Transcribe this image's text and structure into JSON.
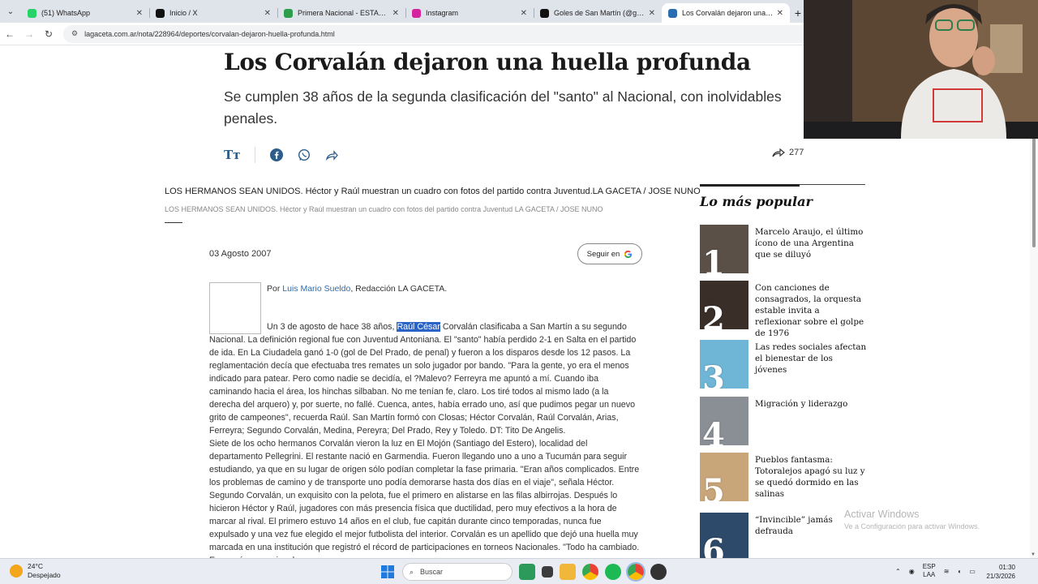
{
  "browser": {
    "tabs": [
      {
        "label": "(51) WhatsApp",
        "color": "#25d366",
        "active": false
      },
      {
        "label": "Inicio / X",
        "color": "#111111",
        "active": false
      },
      {
        "label": "Primera Nacional - ESTADÍSTIC",
        "color": "#2c9e4b",
        "active": false
      },
      {
        "label": "Instagram",
        "color": "#d6249f",
        "active": false
      },
      {
        "label": "Goles de San Martín (@goles.de",
        "color": "#111111",
        "active": false
      },
      {
        "label": "Los Corvalán dejaron una hue",
        "color": "#2a6db0",
        "active": true
      }
    ],
    "url": "lagaceta.com.ar/nota/228964/deportes/corvalan-dejaron-huella-profunda.html"
  },
  "article": {
    "headline": "Los Corvalán dejaron una huella profunda",
    "subhead": "Se cumplen 38 años de la segunda clasificación del \"santo\" al Nacional, con inolvidables penales.",
    "text_size_label": "Tт",
    "share_count": "277",
    "image_alt": "LOS HERMANOS SEAN UNIDOS. Héctor y Raúl muestran un cuadro con fotos del partido contra Juventud.LA GACETA / JOSE NUNO",
    "image_caption": "LOS HERMANOS SEAN UNIDOS. Héctor y Raúl muestran un cuadro con fotos del partido contra Juventud LA GACETA / JOSE NUNO",
    "date": "03 Agosto 2007",
    "follow_label": "Seguir en",
    "byline_prefix": "Por ",
    "author": "Luis Mario Sueldo",
    "byline_suffix": ", Redacción LA GACETA.",
    "para1_before": "Un 3 de agosto de hace 38 años, ",
    "para1_highlight": "Raúl César",
    "para1_after": " Corvalán clasificaba a San Martín a su segundo Nacional. La definición regional fue con Juventud Antoniana. El \"santo\" había perdido 2-1 en Salta en el partido de ida. En La Ciudadela ganó 1-0 (gol de Del Prado, de penal) y fueron a los disparos desde los 12 pasos. La reglamentación decía que efectuaba tres remates un solo jugador por bando. \"Para la gente, yo era el menos indicado para patear. Pero como nadie se decidía, el ?Malevo? Ferreyra me apuntó a mí. Cuando iba caminando hacia el área, los hinchas silbaban. No me tenían fe, claro. Los tiré todos al mismo lado (a la derecha del arquero) y, por suerte, no fallé. Cuenca, antes, había errado uno, así que pudimos pegar un nuevo grito de campeones\", recuerda Raúl. San Martín formó con Closas; Héctor Corvalán, Raúl Corvalán, Arias, Ferreyra; Segundo Corvalán, Medina, Pereyra; Del Prado, Rey y Toledo. DT: Tito De Angelis.",
    "para2": "Siete de los ocho hermanos Corvalán vieron la luz en El Mojón (Santiago del Estero), localidad del departamento Pellegrini. El restante nació en Garmendia. Fueron llegando uno a uno a Tucumán para seguir estudiando, ya que en su lugar de origen sólo podían completar la fase primaria. \"Eran años complicados. Entre los problemas de camino y de transporte uno podía demorarse hasta dos días en el viaje\", señala Héctor. Segundo Corvalán, un exquisito con la pelota, fue el primero en alistarse en las filas albirrojas. Después lo hicieron Héctor y Raúl, jugadores con más presencia física que ductilidad, pero muy efectivos a la hora de marcar al rival. El primero estuvo 14 años en el club, fue capitán durante cinco temporadas, nunca fue expulsado y una vez fue elegido el mejor futbolista del interior. Corvalán es un apellido que dejó una huella muy marcada en una institución que registró el récord de participaciones en torneos Nacionales. \"Todo ha cambiado. En esa época se jugaba y se"
  },
  "sidebar": {
    "title": "Lo más popular",
    "items": [
      {
        "num": "1",
        "text": "Marcelo Araujo, el último ícono de una Argentina que se diluyó",
        "thumb": "#5a5048"
      },
      {
        "num": "2",
        "text": "Con canciones de consagrados, la orquesta estable invita a reflexionar sobre el golpe de 1976",
        "thumb": "#3a2e28"
      },
      {
        "num": "3",
        "text": "Las redes sociales afectan el bienestar de los jóvenes",
        "thumb": "#6fb6d6"
      },
      {
        "num": "4",
        "text": "Migración y liderazgo",
        "thumb": "#8a8f96"
      },
      {
        "num": "5",
        "text": "Pueblos fantasma: Totoralejos apagó su luz y se quedó dormido en las salinas",
        "thumb": "#c9a679"
      },
      {
        "num": "6",
        "text": "“Invincible” jamás defrauda",
        "thumb": "#2e4a6a"
      }
    ]
  },
  "windows_activation": {
    "line1": "Activar Windows",
    "line2": "Ve a Configuración para activar Windows."
  },
  "taskbar": {
    "temp": "24°C",
    "weather": "Despejado",
    "search_placeholder": "Buscar",
    "lang_line1": "ESP",
    "lang_line2": "LAA",
    "time": "01:30",
    "date": "21/3/2026"
  }
}
